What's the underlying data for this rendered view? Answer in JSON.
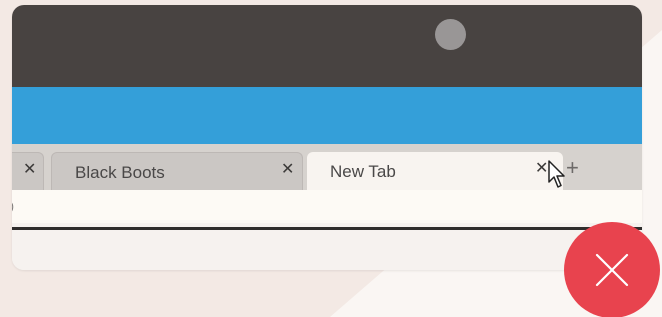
{
  "browser": {
    "tabs": [
      {
        "label": "",
        "close_glyph": "✕",
        "state": "inactive-partial"
      },
      {
        "label": "Black Boots",
        "close_glyph": "✕",
        "state": "inactive"
      },
      {
        "label": "New Tab",
        "close_glyph": "✕",
        "state": "active"
      }
    ],
    "new_tab_glyph": "+",
    "address_bar": {
      "left_glyph": ")"
    }
  },
  "overlay": {
    "close_icon": "x-icon",
    "close_color": "#e8434e"
  },
  "colors": {
    "titlebar": "#484341",
    "banner": "#349fd9",
    "tabstrip": "#d6d2ce",
    "active_tab": "#f8f4f0",
    "page_background": "#f3e9e4"
  },
  "icons": {
    "camera": "camera-dot-icon",
    "cursor": "mouse-pointer-icon"
  }
}
